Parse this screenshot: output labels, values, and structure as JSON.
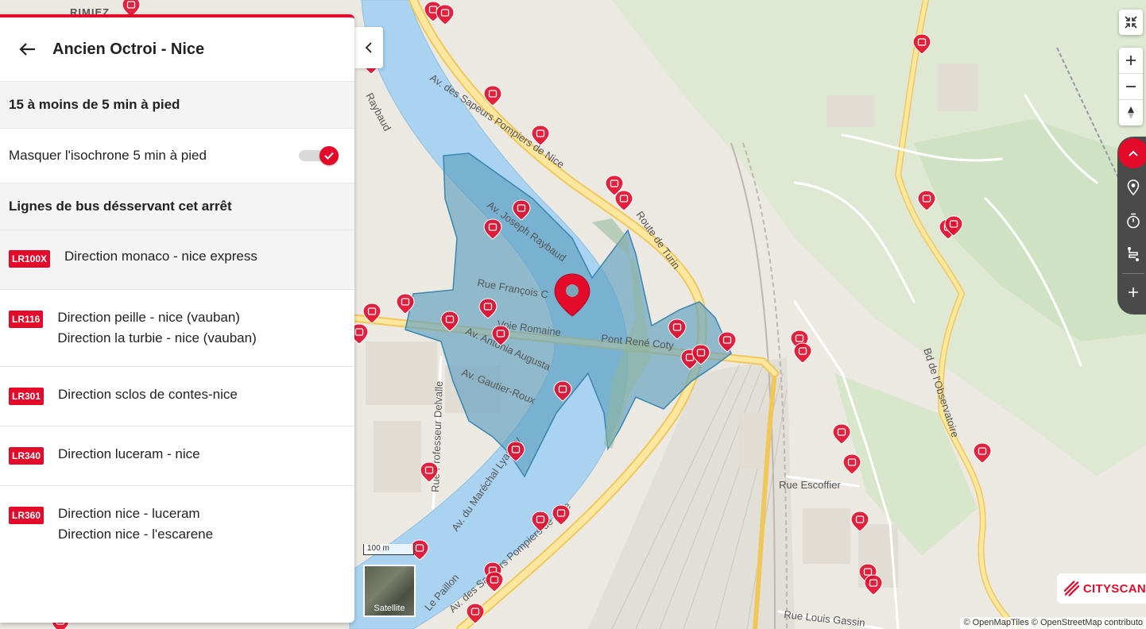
{
  "panel": {
    "title": "Ancien Octroi - Nice",
    "walk_summary": "15 à moins de 5 min à pied",
    "toggle_label": "Masquer l'isochrone 5 min à pied",
    "toggle_on": true,
    "lines_header": "Lignes de bus désservant cet arrêt",
    "lines": [
      {
        "code": "LR100X",
        "directions": [
          "Direction monaco - nice express"
        ]
      },
      {
        "code": "LR116",
        "directions": [
          "Direction peille - nice (vauban)",
          "Direction la turbie - nice (vauban)"
        ]
      },
      {
        "code": "LR301",
        "directions": [
          "Direction sclos de contes-nice"
        ]
      },
      {
        "code": "LR340",
        "directions": [
          "Direction luceram - nice"
        ]
      },
      {
        "code": "LR360",
        "directions": [
          "Direction nice - luceram",
          "Direction nice - l'escarene"
        ]
      }
    ]
  },
  "map": {
    "street_labels": {
      "rimiez": "RIMIEZ",
      "raybaud": "Raybaud",
      "sapeurs_top": "Av. des Sapeurs Pompiers de Nice",
      "joseph_raybaud": "Av. Joseph Raybaud",
      "route_turin": "Route de Turin",
      "francois": "Rue François C",
      "voie_romaine": "Voie Romaine",
      "antonia": "Av. Antonia Augusta",
      "pont_rene": "Pont René Coty",
      "gautier": "Av. Gautier-Roux",
      "delvalle": "Rue Professeur Delvalle",
      "lyautey": "Av. du Maréchal Lyautey",
      "sapeurs_bottom": "Av. des Sapeurs Pompiers de Nice",
      "paillon": "Le Paillon",
      "observatoire": "Bd de l'Observatoire",
      "escoffier": "Rue Escoffier",
      "louis": "Rue Louis Gassin"
    },
    "scale_label": "100 m",
    "satellite_label": "Satellite",
    "brand": "CITYSCAN",
    "attribution": "© OpenMapTiles © OpenStreetMap contributo",
    "colors": {
      "accent": "#e30a2a",
      "river": "#a9d3f0",
      "isochrone": "#6aa7c4",
      "road": "#f5d97a"
    }
  }
}
